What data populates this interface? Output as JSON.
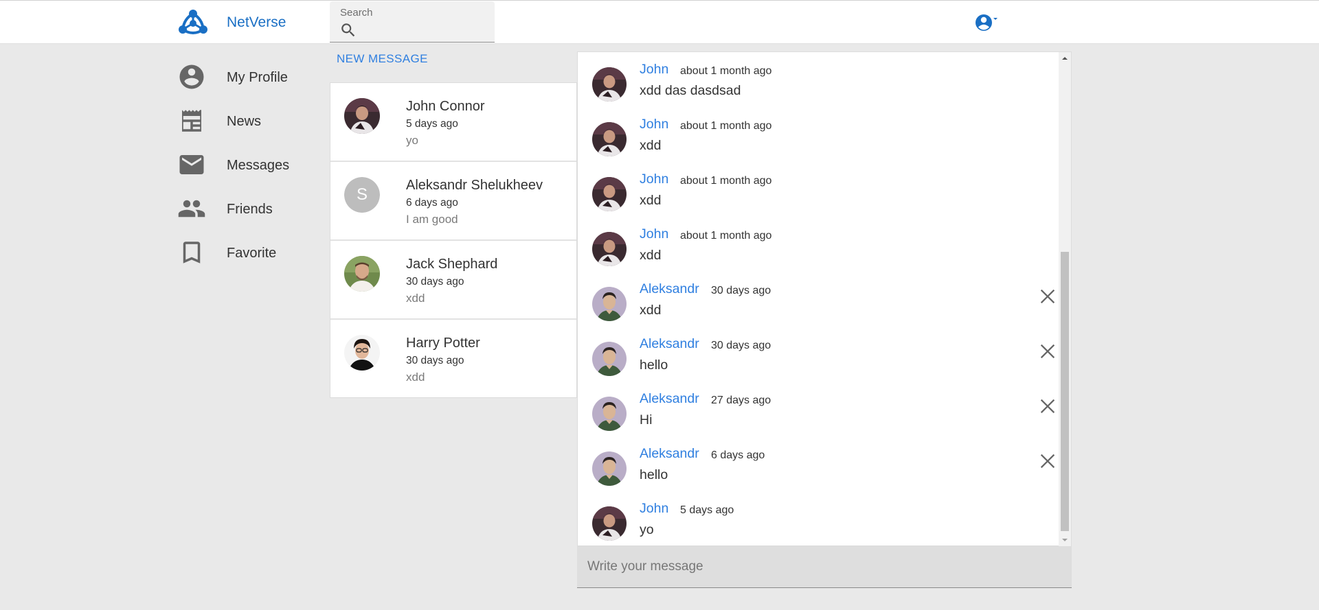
{
  "header": {
    "brand": "NetVerse",
    "search_label": "Search"
  },
  "sidebar": {
    "items": [
      {
        "label": "My Profile",
        "icon": "account-circle-icon"
      },
      {
        "label": "News",
        "icon": "news-icon"
      },
      {
        "label": "Messages",
        "icon": "mail-icon"
      },
      {
        "label": "Friends",
        "icon": "people-icon"
      },
      {
        "label": "Favorite",
        "icon": "bookmark-icon"
      }
    ]
  },
  "conversations": {
    "new_message_label": "NEW MESSAGE",
    "items": [
      {
        "name": "John Connor",
        "time": "5 days ago",
        "last": "yo",
        "avatar": "photo"
      },
      {
        "name": "Aleksandr Shelukheev",
        "time": "6 days ago",
        "last": "I am good",
        "avatar_letter": "S"
      },
      {
        "name": "Jack Shephard",
        "time": "30 days ago",
        "last": "xdd",
        "avatar": "photo"
      },
      {
        "name": "Harry Potter",
        "time": "30 days ago",
        "last": "xdd",
        "avatar": "photo"
      }
    ]
  },
  "chat": {
    "messages": [
      {
        "author": "John",
        "time": "about 1 month ago",
        "text": "xdd das dasdsad",
        "deletable": false
      },
      {
        "author": "John",
        "time": "about 1 month ago",
        "text": "xdd",
        "deletable": false
      },
      {
        "author": "John",
        "time": "about 1 month ago",
        "text": "xdd",
        "deletable": false
      },
      {
        "author": "John",
        "time": "about 1 month ago",
        "text": "xdd",
        "deletable": false
      },
      {
        "author": "Aleksandr",
        "time": "30 days ago",
        "text": "xdd",
        "deletable": true
      },
      {
        "author": "Aleksandr",
        "time": "30 days ago",
        "text": "hello",
        "deletable": true
      },
      {
        "author": "Aleksandr",
        "time": "27 days ago",
        "text": "Hi",
        "deletable": true
      },
      {
        "author": "Aleksandr",
        "time": "6 days ago",
        "text": "hello",
        "deletable": true
      },
      {
        "author": "John",
        "time": "5 days ago",
        "text": "yo",
        "deletable": false
      }
    ],
    "composer_placeholder": "Write your message"
  },
  "colors": {
    "accent": "#2f7fe0",
    "brand": "#1a6fc4",
    "background": "#e9e9e9"
  }
}
